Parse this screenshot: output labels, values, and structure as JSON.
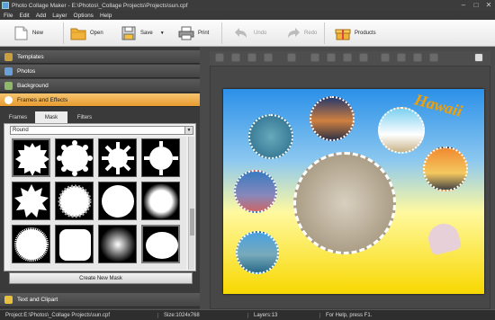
{
  "titlebar": {
    "title": "Photo Collage Maker - E:\\Photos\\_Collage Projects\\Projects\\sun.cpf"
  },
  "menu": [
    "File",
    "Edit",
    "Add",
    "Layer",
    "Options",
    "Help"
  ],
  "toolbar": {
    "new": "New",
    "open": "Open",
    "save": "Save",
    "print": "Print",
    "undo": "Undo",
    "redo": "Redo",
    "products": "Products"
  },
  "panels": {
    "templates": "Templates",
    "photos": "Photos",
    "background": "Background",
    "frames": "Frames and Effects",
    "text": "Text and Clipart"
  },
  "tabs": {
    "frames": "Frames",
    "mask": "Mask",
    "filters": "Filters"
  },
  "mask": {
    "selected": "Round",
    "create_button": "Create New Mask"
  },
  "collage": {
    "caption": "Hawaii"
  },
  "status": {
    "project": "Project:E:\\Photos\\_Collage Projects\\sun.cpf",
    "size": "Size:1024x768",
    "layers": "Layers:13",
    "help": "For Help, press F1."
  },
  "colors": {
    "accent": "#e89a30",
    "panel": "#3a3a3a",
    "caption": "#f5a000"
  }
}
